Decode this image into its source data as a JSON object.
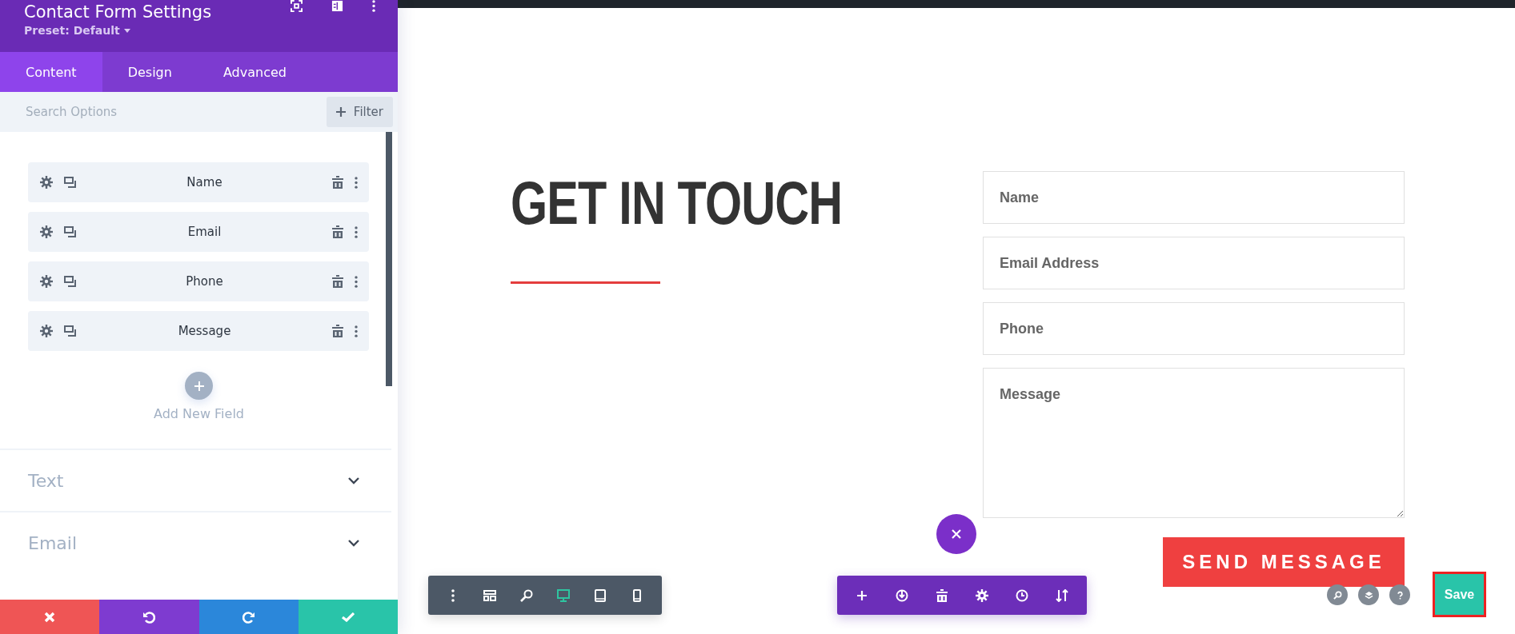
{
  "panel": {
    "title": "Contact Form Settings",
    "preset": "Preset: Default",
    "tabs": [
      {
        "label": "Content",
        "selected": true
      },
      {
        "label": "Design",
        "selected": false
      },
      {
        "label": "Advanced",
        "selected": false
      }
    ],
    "search": {
      "placeholder": "Search Options"
    },
    "filter_button": "Filter",
    "fields": [
      {
        "label": "Name"
      },
      {
        "label": "Email"
      },
      {
        "label": "Phone"
      },
      {
        "label": "Message"
      }
    ],
    "add_field": "Add New Field",
    "sections": [
      {
        "label": "Text",
        "expanded": false
      },
      {
        "label": "Email",
        "expanded": false
      }
    ]
  },
  "canvas": {
    "heading": "GET IN TOUCH",
    "form": [
      {
        "kind": "input",
        "placeholder": "Name"
      },
      {
        "kind": "input",
        "placeholder": "Email Address"
      },
      {
        "kind": "input",
        "placeholder": "Phone"
      },
      {
        "kind": "textarea",
        "placeholder": "Message"
      }
    ],
    "send_button": "SEND MESSAGE",
    "view_toolbar": [
      {
        "kind": "menu",
        "selected": false
      },
      {
        "kind": "wireframe",
        "selected": false
      },
      {
        "kind": "zoom",
        "selected": false
      },
      {
        "kind": "desktop",
        "selected": true
      },
      {
        "kind": "tablet",
        "selected": false
      },
      {
        "kind": "phone",
        "selected": false
      }
    ],
    "save_button": "Save"
  }
}
